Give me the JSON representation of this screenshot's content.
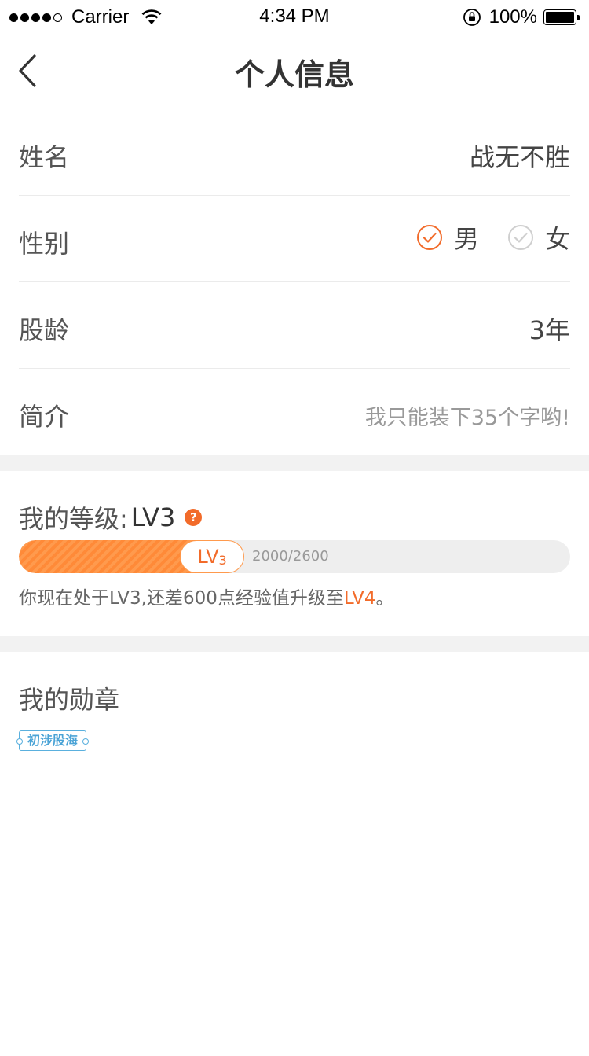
{
  "status_bar": {
    "carrier": "Carrier",
    "time": "4:34 PM",
    "battery": "100%",
    "signal_bars": 5,
    "signal_filled": 4
  },
  "nav": {
    "title": "个人信息",
    "back_icon": "chevron-left-icon"
  },
  "profile": {
    "name_label": "姓名",
    "name_value": "战无不胜",
    "gender_label": "性别",
    "gender_options": [
      {
        "label": "男",
        "selected": true
      },
      {
        "label": "女",
        "selected": false
      }
    ],
    "age_label": "股龄",
    "age_value": "3年",
    "bio_label": "简介",
    "bio_placeholder": "我只能装下35个字哟!"
  },
  "level": {
    "title": "我的等级:",
    "current": "LV3",
    "badge_lv": "LV",
    "badge_num": "3",
    "progress_text": "2000/2600",
    "progress_current": 2000,
    "progress_total": 2600,
    "desc_prefix": "你现在处于LV3,还差600点经验值升级至",
    "desc_next": "LV4",
    "desc_suffix": "。",
    "accent_color": "#f26b2a"
  },
  "medals": {
    "title": "我的勋章",
    "items": [
      "初涉股海"
    ]
  }
}
